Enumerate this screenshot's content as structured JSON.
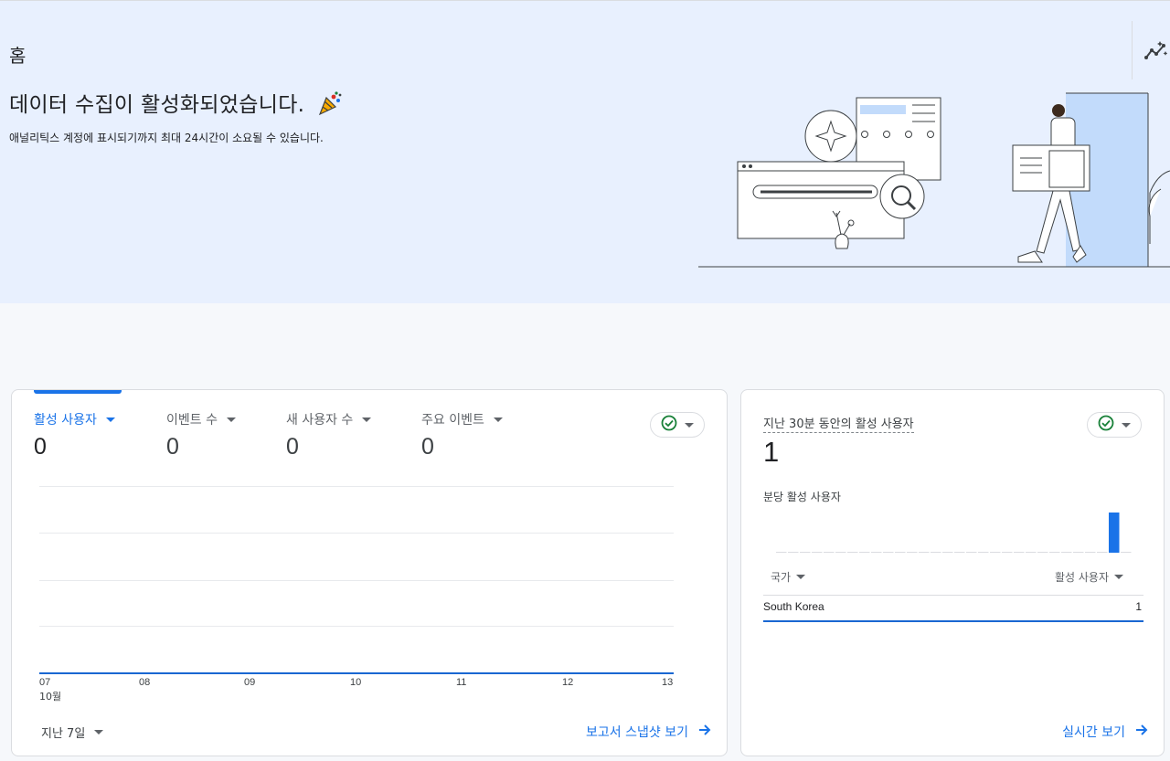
{
  "header": {
    "page_title": "홈",
    "heading": "데이터 수집이 활성화되었습니다.",
    "subtext": "애널리틱스 계정에 표시되기까지 최대 24시간이 소요될 수 있습니다.",
    "insights_icon": "insights-icon"
  },
  "overview_card": {
    "metrics": [
      {
        "label": "활성 사용자",
        "value": "0"
      },
      {
        "label": "이벤트 수",
        "value": "0"
      },
      {
        "label": "새 사용자 수",
        "value": "0"
      },
      {
        "label": "주요 이벤트",
        "value": "0"
      }
    ],
    "status_icon": "check-circle-icon",
    "x_ticks": [
      "07",
      "08",
      "09",
      "10",
      "11",
      "12",
      "13"
    ],
    "x_month": "10월",
    "date_range": "지난 7일",
    "view_link": "보고서 스냅샷 보기"
  },
  "realtime_card": {
    "title": "지난 30분 동안의 활성 사용자",
    "value": "1",
    "subtitle": "분당 활성 사용자",
    "per_minute_users": [
      0,
      0,
      0,
      0,
      0,
      0,
      0,
      0,
      0,
      0,
      0,
      0,
      0,
      0,
      0,
      0,
      0,
      0,
      0,
      0,
      0,
      0,
      0,
      0,
      0,
      0,
      0,
      0,
      1,
      0
    ],
    "col_country": "국가",
    "col_users": "활성 사용자",
    "rows": [
      {
        "country": "South Korea",
        "users": "1"
      }
    ],
    "view_link": "실시간 보기"
  },
  "colors": {
    "accent": "#1a73e8",
    "hero_bg": "#e8f0fe",
    "success": "#188038"
  },
  "chart_data": {
    "type": "line",
    "x": [
      "07",
      "08",
      "09",
      "10",
      "11",
      "12",
      "13"
    ],
    "series": [
      {
        "name": "활성 사용자",
        "values": [
          0,
          0,
          0,
          0,
          0,
          0,
          0
        ]
      }
    ],
    "xlabel": "10월",
    "grid": true
  }
}
